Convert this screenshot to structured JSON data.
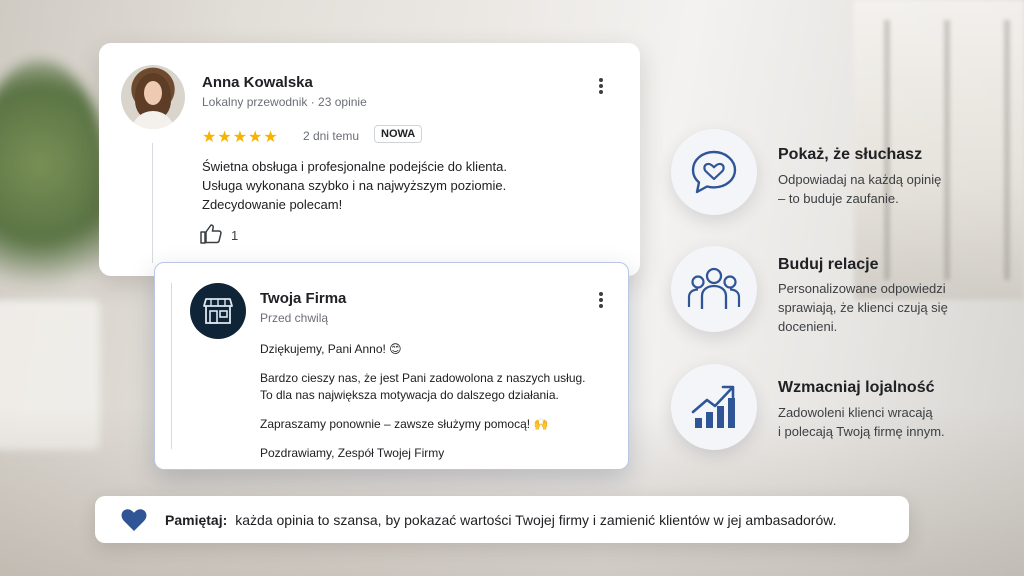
{
  "review": {
    "author": "Anna Kowalska",
    "meta": "Lokalny przewodnik · 23 opinie",
    "stars": "★★★★★",
    "rating": 5,
    "time": "2 dni temu",
    "badge": "NOWA",
    "text_lines": [
      "Świetna obsługa i profesjonalne podejście do klienta.",
      "Usługa wykonana szybko i na najwyższym poziomie.",
      "Zdecydowanie polecam!"
    ],
    "likes": "1",
    "icons": {
      "avatar": "user-avatar",
      "more": "more-vert-icon",
      "like": "thumbs-up-icon"
    }
  },
  "reply": {
    "author": "Twoja Firma",
    "meta": "Przed chwilą",
    "paragraphs": [
      "Dziękujemy, Pani Anno! 😊",
      "Bardzo cieszy nas, że jest Pani zadowolona z naszych usług.",
      "To dla nas największa motywacja do dalszego działania.",
      "Zapraszamy ponownie – zawsze służymy pomocą! 🙌",
      "Pozdrawiamy, Zespół Twojej Firmy"
    ],
    "icons": {
      "logo": "storefront-icon",
      "more": "more-vert-icon"
    }
  },
  "features": [
    {
      "title": "Pokaż, że słuchasz",
      "desc": [
        "Odpowiadaj na każdą opinię",
        "– to buduje zaufanie."
      ],
      "icon": "heart-chat-icon"
    },
    {
      "title": "Buduj relacje",
      "desc": [
        "Personalizowane odpowiedzi",
        "sprawiają, że klienci czują się",
        "docenieni."
      ],
      "icon": "people-icon"
    },
    {
      "title": "Wzmacniaj lojalność",
      "desc": [
        "Zadowoleni klienci wracają",
        "i polecają Twoją firmę innym."
      ],
      "icon": "growth-chart-icon"
    }
  ],
  "tip": {
    "label": "Pamiętaj:",
    "text": "każda opinia to szansa, by pokazać wartości Twojej firmy i zamienić klientów w jej ambasadorów.",
    "icon": "heart-icon"
  },
  "colors": {
    "accent": "#2f5597",
    "star": "#f5b400",
    "logo_bg": "#0f2436"
  }
}
